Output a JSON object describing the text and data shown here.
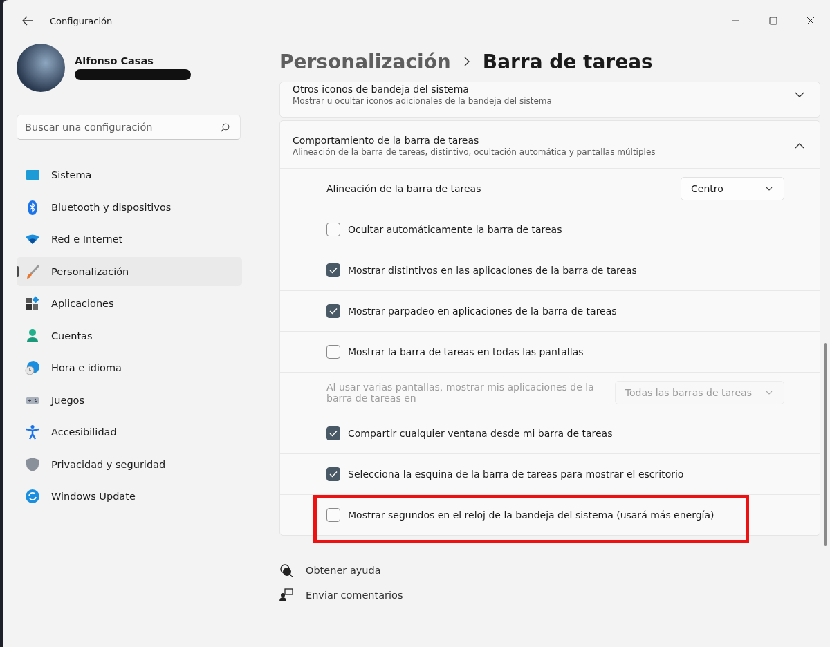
{
  "window": {
    "title": "Configuración"
  },
  "user": {
    "name": "Alfonso Casas"
  },
  "search": {
    "placeholder": "Buscar una configuración"
  },
  "nav": [
    {
      "label": "Sistema",
      "kind": "system",
      "selected": false
    },
    {
      "label": "Bluetooth y dispositivos",
      "kind": "bluetooth",
      "selected": false
    },
    {
      "label": "Red e Internet",
      "kind": "wifi",
      "selected": false
    },
    {
      "label": "Personalización",
      "kind": "brush",
      "selected": true
    },
    {
      "label": "Aplicaciones",
      "kind": "apps",
      "selected": false
    },
    {
      "label": "Cuentas",
      "kind": "person",
      "selected": false
    },
    {
      "label": "Hora e idioma",
      "kind": "clock",
      "selected": false
    },
    {
      "label": "Juegos",
      "kind": "gamepad",
      "selected": false
    },
    {
      "label": "Accesibilidad",
      "kind": "accessibility",
      "selected": false
    },
    {
      "label": "Privacidad y seguridad",
      "kind": "shield",
      "selected": false
    },
    {
      "label": "Windows Update",
      "kind": "update",
      "selected": false
    }
  ],
  "breadcrumb": {
    "parent": "Personalización",
    "current": "Barra de tareas"
  },
  "sections": [
    {
      "title": "Otros iconos de bandeja del sistema",
      "subtitle": "Mostrar u ocultar iconos adicionales de la bandeja del sistema",
      "expanded": false
    },
    {
      "title": "Comportamiento de la barra de tareas",
      "subtitle": "Alineación de la barra de tareas, distintivo, ocultación automática y pantallas múltiples",
      "expanded": true,
      "rows": [
        {
          "kind": "dropdown",
          "label": "Alineación de la barra de tareas",
          "value": "Centro",
          "disabled": false,
          "highlighted": false
        },
        {
          "kind": "checkbox",
          "label": "Ocultar automáticamente la barra de tareas",
          "checked": false,
          "highlighted": false
        },
        {
          "kind": "checkbox",
          "label": "Mostrar distintivos en las aplicaciones de la barra de tareas",
          "checked": true,
          "highlighted": false
        },
        {
          "kind": "checkbox",
          "label": "Mostrar parpadeo en aplicaciones de la barra de tareas",
          "checked": true,
          "highlighted": false
        },
        {
          "kind": "checkbox",
          "label": "Mostrar la barra de tareas en todas las pantallas",
          "checked": false,
          "highlighted": false
        },
        {
          "kind": "dropdown",
          "label": "Al usar varias pantallas, mostrar mis aplicaciones de la barra de tareas en",
          "value": "Todas las barras de tareas",
          "disabled": true,
          "highlighted": false
        },
        {
          "kind": "checkbox",
          "label": "Compartir cualquier ventana desde mi barra de tareas",
          "checked": true,
          "highlighted": false
        },
        {
          "kind": "checkbox",
          "label": "Selecciona la esquina de la barra de tareas para mostrar el escritorio",
          "checked": true,
          "highlighted": false
        },
        {
          "kind": "checkbox",
          "label": "Mostrar segundos en el reloj de la bandeja del sistema (usará más energía)",
          "checked": false,
          "highlighted": true
        }
      ]
    }
  ],
  "footer_links": [
    {
      "label": "Obtener ayuda",
      "kind": "help"
    },
    {
      "label": "Enviar comentarios",
      "kind": "feedback"
    }
  ]
}
